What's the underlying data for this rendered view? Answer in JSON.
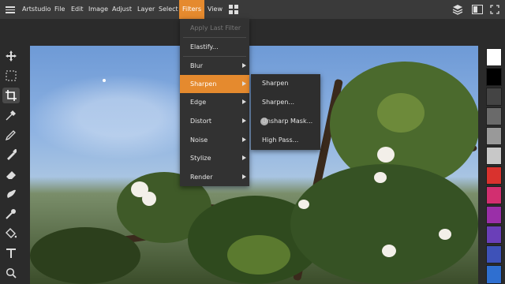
{
  "app": {
    "name": "Artstudio"
  },
  "menubar": {
    "items": [
      "File",
      "Edit",
      "Image",
      "Adjust",
      "Layer",
      "Select",
      "Filters",
      "View"
    ],
    "active": "Filters"
  },
  "filters_menu": {
    "items": [
      {
        "label": "Apply Last Filter",
        "disabled": true
      },
      {
        "label": "Elastify..."
      },
      {
        "label": "Blur",
        "submenu": true
      },
      {
        "label": "Sharpen",
        "submenu": true,
        "active": true
      },
      {
        "label": "Edge",
        "submenu": true
      },
      {
        "label": "Distort",
        "submenu": true
      },
      {
        "label": "Noise",
        "submenu": true
      },
      {
        "label": "Stylize",
        "submenu": true
      },
      {
        "label": "Render",
        "submenu": true
      }
    ]
  },
  "sharpen_submenu": {
    "items": [
      "Sharpen",
      "Sharpen...",
      "Unsharp Mask...",
      "High Pass..."
    ]
  },
  "tools": [
    "move-icon",
    "marquee-select-icon",
    "crop-icon",
    "eyedropper-icon",
    "pencil-icon",
    "brush-icon",
    "eraser-icon",
    "smudge-icon",
    "clone-icon",
    "fill-bucket-icon",
    "text-icon",
    "zoom-icon"
  ],
  "active_tool": "crop-icon",
  "colors": {
    "accent": "#e58a2e",
    "swatches": [
      "#ffffff",
      "#000000",
      "#444444",
      "#6a6a6a",
      "#999999",
      "#c8c8c8",
      "#d9322e",
      "#d22f70",
      "#9a2fa8",
      "#6a3fb8",
      "#3e52b8",
      "#2f6fd0"
    ]
  }
}
